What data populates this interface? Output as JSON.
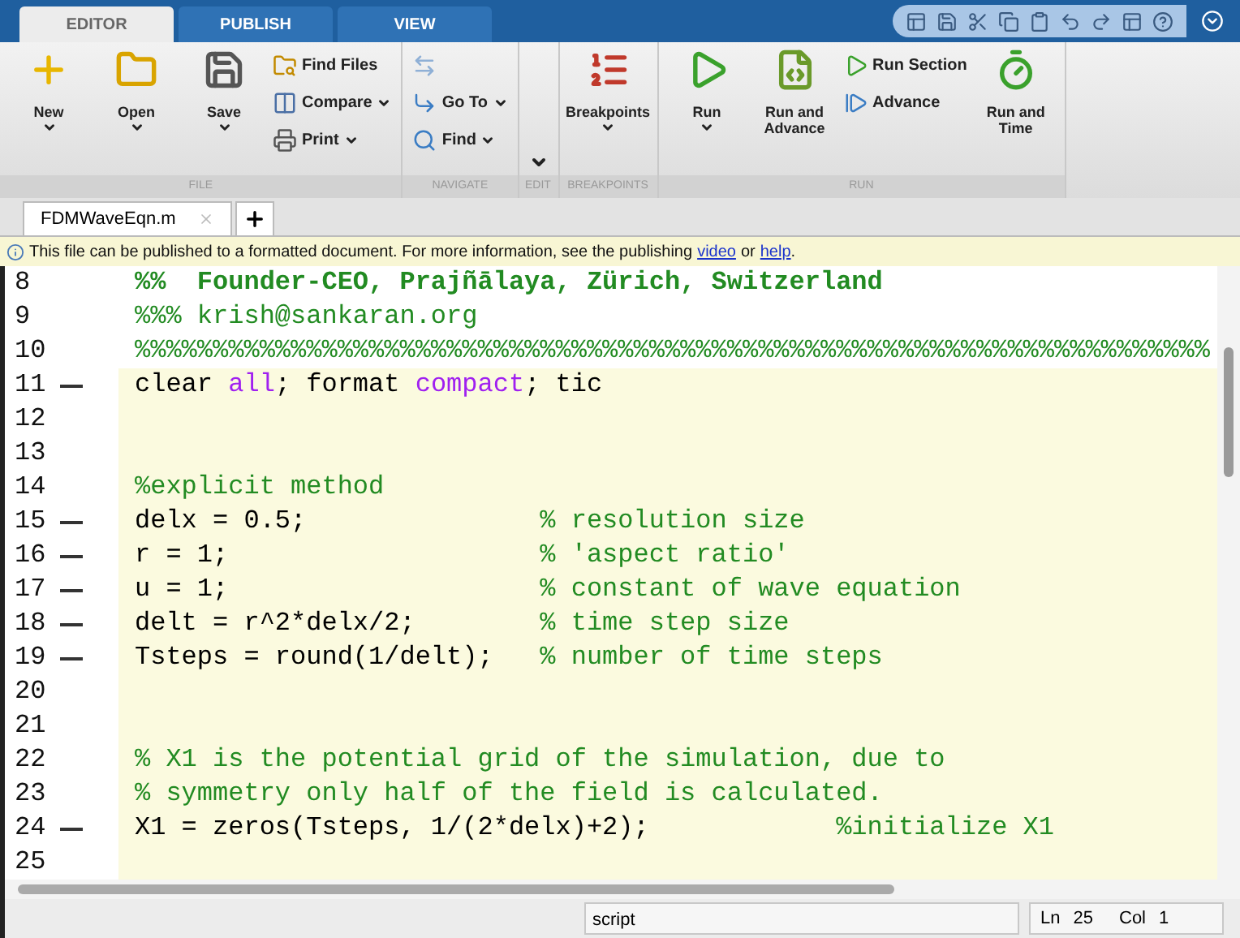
{
  "toolstrip_tabs": [
    {
      "label": "EDITOR",
      "selected": true
    },
    {
      "label": "PUBLISH",
      "selected": false
    },
    {
      "label": "VIEW",
      "selected": false
    }
  ],
  "ribbon": [
    {
      "label": "FILE",
      "items": [
        {
          "kind": "large",
          "label": "New",
          "menu": true
        },
        {
          "kind": "large",
          "label": "Open",
          "menu": true
        },
        {
          "kind": "large",
          "label": "Save",
          "menu": true
        },
        {
          "kind": "stack",
          "rows": [
            {
              "label": "Find Files",
              "menu": false
            },
            {
              "label": "Compare",
              "menu": true
            },
            {
              "label": "Print",
              "menu": true
            }
          ]
        }
      ]
    },
    {
      "label": "NAVIGATE",
      "items": [
        {
          "kind": "stack",
          "rows": [
            {
              "kind": "arrows"
            },
            {
              "label": "Go To",
              "menu": true
            },
            {
              "label": "Find",
              "menu": true
            }
          ]
        }
      ]
    },
    {
      "label": "EDIT",
      "kind": "collapsed"
    },
    {
      "label": "BREAKPOINTS",
      "items": [
        {
          "kind": "large",
          "label": "Breakpoints",
          "menu": true
        }
      ]
    },
    {
      "label": "RUN",
      "items": [
        {
          "kind": "large",
          "label": "Run",
          "menu": true
        },
        {
          "kind": "large",
          "label": "Run and Advance",
          "menu": false
        },
        {
          "kind": "stack",
          "rows": [
            {
              "label": "Run Section",
              "menu": false
            },
            {
              "label": "Advance",
              "menu": false
            }
          ]
        },
        {
          "kind": "large",
          "label": "Run and Time",
          "menu": false
        }
      ]
    }
  ],
  "file_tabs": [
    {
      "label": "FDMWaveEqn.m",
      "selected": true
    }
  ],
  "info_bar": {
    "text": "This file can be published to a formatted document. For more information, see the publishing",
    "link1": "video",
    "joiner": "or",
    "link2": "help",
    "end": "."
  },
  "code_lines": [
    {
      "number": "8",
      "executable": false,
      "highlighted": false,
      "segments": [
        {
          "kind": "cell",
          "text": "%%  Founder-CEO, Prajñālaya, Zürich, Switzerland"
        }
      ]
    },
    {
      "number": "9",
      "executable": false,
      "highlighted": false,
      "segments": [
        {
          "kind": "comment",
          "text": "%%% krish@sankaran.org"
        }
      ]
    },
    {
      "number": "10",
      "executable": false,
      "highlighted": false,
      "segments": [
        {
          "kind": "comment",
          "text": "%%%%%%%%%%%%%%%%%%%%%%%%%%%%%%%%%%%%%%%%%%%%%%%%%%%%%%%%%%%%%%%%%%%%%"
        }
      ]
    },
    {
      "number": "11",
      "executable": true,
      "highlighted": true,
      "segments": [
        {
          "kind": "code",
          "text": "clear "
        },
        {
          "kind": "string",
          "text": "all"
        },
        {
          "kind": "code",
          "text": "; format "
        },
        {
          "kind": "string",
          "text": "compact"
        },
        {
          "kind": "code",
          "text": "; tic"
        }
      ]
    },
    {
      "number": "12",
      "executable": false,
      "highlighted": true
    },
    {
      "number": "13",
      "executable": false,
      "highlighted": true
    },
    {
      "number": "14",
      "executable": false,
      "highlighted": true,
      "segments": [
        {
          "kind": "comment",
          "text": "%explicit method"
        }
      ]
    },
    {
      "number": "15",
      "executable": true,
      "highlighted": true,
      "segments": [
        {
          "kind": "code",
          "text": "delx = 0.5;"
        },
        {
          "kind": "comment",
          "text": "% resolution size"
        }
      ]
    },
    {
      "number": "16",
      "executable": true,
      "highlighted": true,
      "segments": [
        {
          "kind": "code",
          "text": "r = 1;"
        },
        {
          "kind": "comment",
          "text": "% 'aspect ratio'"
        }
      ]
    },
    {
      "number": "17",
      "executable": true,
      "highlighted": true,
      "segments": [
        {
          "kind": "code",
          "text": "u = 1;"
        },
        {
          "kind": "comment",
          "text": "% constant of wave equation"
        }
      ]
    },
    {
      "number": "18",
      "executable": true,
      "highlighted": true,
      "segments": [
        {
          "kind": "code",
          "text": "delt = r^2*delx/2;"
        },
        {
          "kind": "comment",
          "text": "% time step size"
        }
      ]
    },
    {
      "number": "19",
      "executable": true,
      "highlighted": true,
      "segments": [
        {
          "kind": "code",
          "text": "Tsteps = round(1/delt);"
        },
        {
          "kind": "comment",
          "text": "% number of time steps"
        }
      ]
    },
    {
      "number": "20",
      "executable": false,
      "highlighted": true
    },
    {
      "number": "21",
      "executable": false,
      "highlighted": true
    },
    {
      "number": "22",
      "executable": false,
      "highlighted": true,
      "segments": [
        {
          "kind": "comment",
          "text": "% X1 is the potential grid of the simulation, due to"
        }
      ]
    },
    {
      "number": "23",
      "executable": false,
      "highlighted": true,
      "segments": [
        {
          "kind": "comment",
          "text": "% symmetry only half of the field is calculated."
        }
      ]
    },
    {
      "number": "24",
      "executable": true,
      "highlighted": true,
      "segments": [
        {
          "kind": "code",
          "text": "X1 = zeros(Tsteps, 1/(2*delx)+2);"
        },
        {
          "kind": "comment",
          "text": "%initialize X1"
        }
      ]
    },
    {
      "number": "25",
      "executable": false,
      "highlighted": true
    }
  ],
  "status_bar": {
    "file_type": "script",
    "line_label": "Ln",
    "line": "25",
    "col_label": "Col",
    "col": "1"
  }
}
